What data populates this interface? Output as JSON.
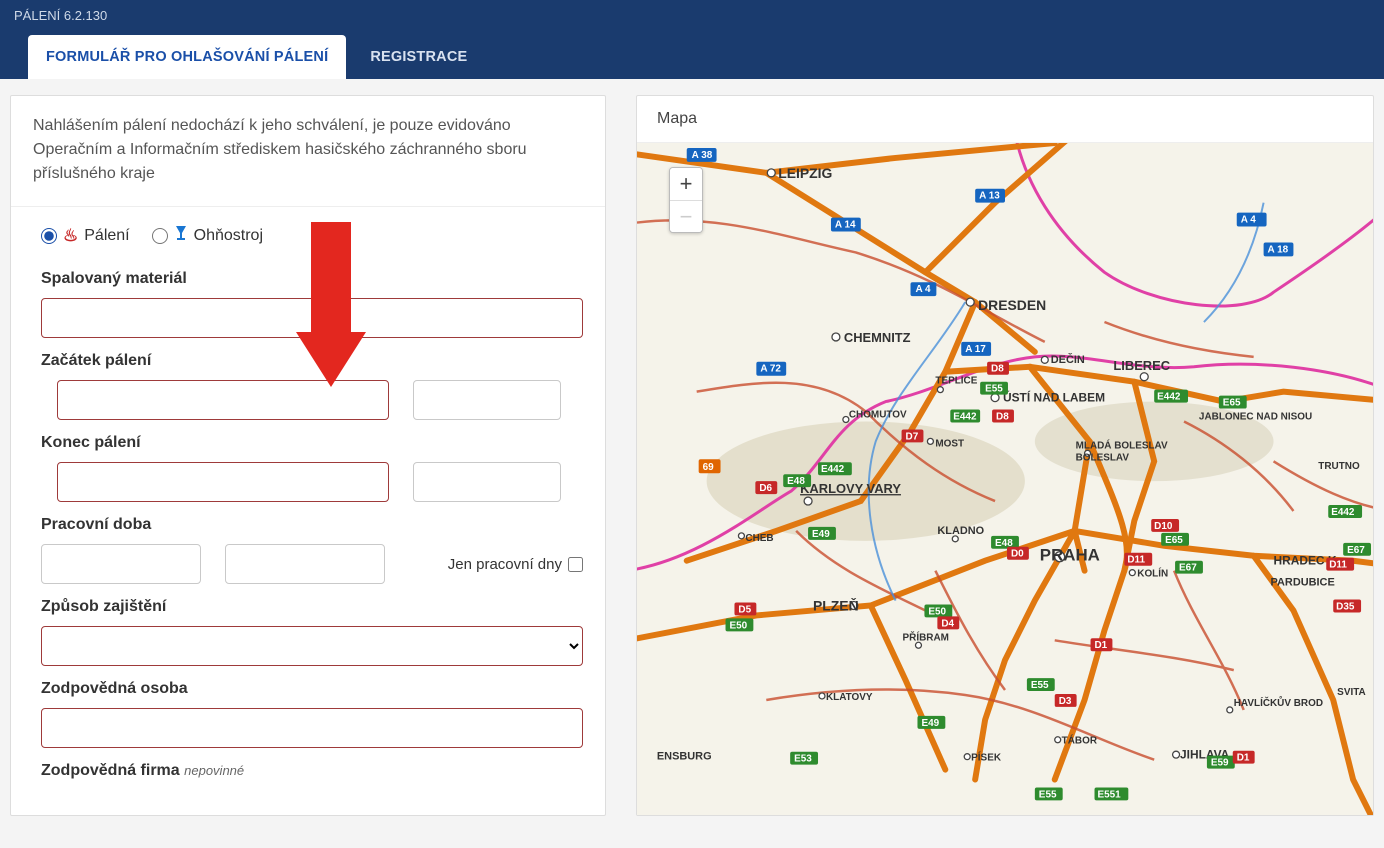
{
  "app": {
    "title": "PÁLENÍ 6.2.130"
  },
  "tabs": {
    "form": "FORMULÁŘ PRO OHLAŠOVÁNÍ PÁLENÍ",
    "register": "REGISTRACE"
  },
  "intro": "Nahlášením pálení nedochází k jeho schválení, je pouze evidováno Operačním a Informačním střediskem hasičského záchranného sboru příslušného kraje",
  "radios": {
    "burning": "Pálení",
    "fireworks": "Ohňostroj"
  },
  "fields": {
    "material": "Spalovaný materiál",
    "start": "Začátek pálení",
    "end": "Konec pálení",
    "hours": "Pracovní doba",
    "workdays": "Jen pracovní dny",
    "method": "Způsob zajištění",
    "person": "Zodpovědná osoba",
    "company": "Zodpovědná firma",
    "optional": "nepovinné"
  },
  "map": {
    "title": "Mapa",
    "cities": {
      "leipzig": "LEIPZIG",
      "dresden": "DRESDEN",
      "chemnitz": "CHEMNITZ",
      "decin": "DEČIN",
      "liberec": "LIBEREC",
      "usti": "ÚSTÍ NAD LABEM",
      "teplice": "TEPLICE",
      "chomutov": "CHOMUTOV",
      "most": "MOST",
      "jablonec": "JABLONEC NAD NISOU",
      "mlada": "MLADÁ BOLESLAV",
      "karlovyvary": "KARLOVY VARY",
      "cheb": "CHEB",
      "kladno": "KLADNO",
      "praha": "PRAHA",
      "kolin": "KOLÍN",
      "hradec": "HRADEC K",
      "pardubice": "PARDUBICE",
      "trutnov": "TRUTNO",
      "plzen": "PLZEŇ",
      "pribram": "PŘÍBRAM",
      "klatovy": "KLATOVY",
      "tabor": "TÁBOR",
      "pisek": "PÍSEK",
      "jihlava": "JIHLAVA",
      "havlickuv": "HAVLÍČKŮV BROD",
      "svita": "SVITA",
      "ensburg": "ENSBURG"
    },
    "routes": {
      "a38": "A 38",
      "a4": "A 4",
      "a13": "A 13",
      "a14": "A 14",
      "a17": "A 17",
      "a72": "A 72",
      "a18": "A 18",
      "e49": "E49",
      "e48": "E48",
      "e50": "E50",
      "e53": "E53",
      "e55": "E55",
      "e65": "E65",
      "e67": "E67",
      "e442": "E442",
      "e551": "E551",
      "e59": "E59",
      "d0": "D0",
      "d1": "D1",
      "d3": "D3",
      "d4": "D4",
      "d5": "D5",
      "d6": "D6",
      "d7": "D7",
      "d8": "D8",
      "d10": "D10",
      "d11": "D11",
      "d35": "D35"
    }
  }
}
